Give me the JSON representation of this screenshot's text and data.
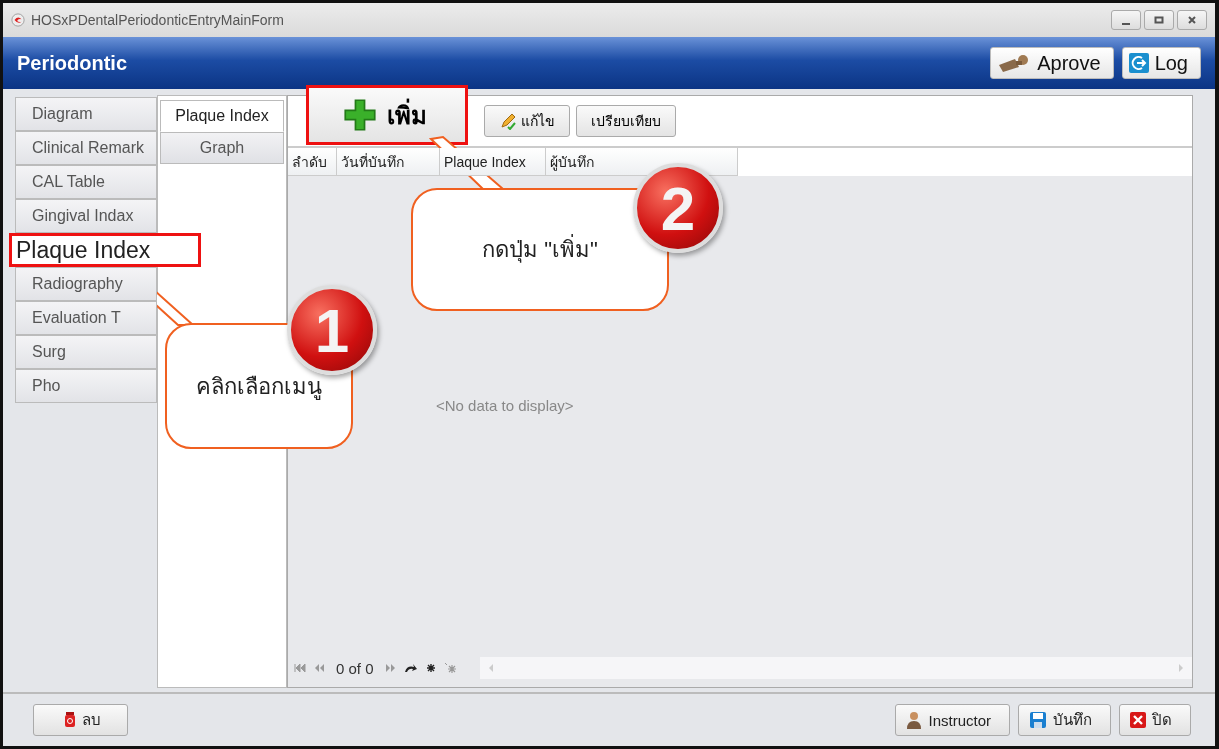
{
  "window": {
    "title": "HOSxPDentalPeriodonticEntryMainForm"
  },
  "header": {
    "title": "Periodontic",
    "buttons": [
      {
        "label": "Aprove"
      },
      {
        "label": "Log"
      }
    ]
  },
  "sidebar": {
    "items": [
      {
        "label": "Diagram",
        "highlighted": false
      },
      {
        "label": "Clinical Remark",
        "highlighted": false
      },
      {
        "label": "CAL Table",
        "highlighted": false
      },
      {
        "label": "Gingival Indax",
        "highlighted": false
      },
      {
        "label": "Plaque Index",
        "highlighted": true
      },
      {
        "label": "Radiography",
        "highlighted": false
      },
      {
        "label": "Evaluation T",
        "highlighted": false
      },
      {
        "label": "Surg",
        "highlighted": false
      },
      {
        "label": "Pho",
        "highlighted": false
      }
    ]
  },
  "subtabs": [
    {
      "label": "Plaque Index",
      "selected": true
    },
    {
      "label": "Graph",
      "selected": false
    }
  ],
  "toolbar": [
    {
      "label": "เพิ่ม",
      "highlighted": true
    },
    {
      "label": "แก้ไข",
      "highlighted": false
    },
    {
      "label": "เปรียบเทียบ",
      "highlighted": false
    }
  ],
  "table": {
    "columns": [
      "ลำดับ",
      "วันที่บันทึก",
      "Plaque Index",
      "ผู้บันทึก"
    ],
    "empty_text": "<No data to display>"
  },
  "navigator": {
    "position": "0 of 0"
  },
  "footer": {
    "left_buttons": [
      {
        "label": "ลบ"
      }
    ],
    "right_buttons": [
      {
        "label": "Instructor"
      },
      {
        "label": "บันทึก"
      },
      {
        "label": "ปิด"
      }
    ]
  },
  "callouts": [
    {
      "number": "1",
      "text": "คลิกเลือกเมนู"
    },
    {
      "number": "2",
      "text": "กดปุ่ม \"เพิ่ม\""
    }
  ]
}
